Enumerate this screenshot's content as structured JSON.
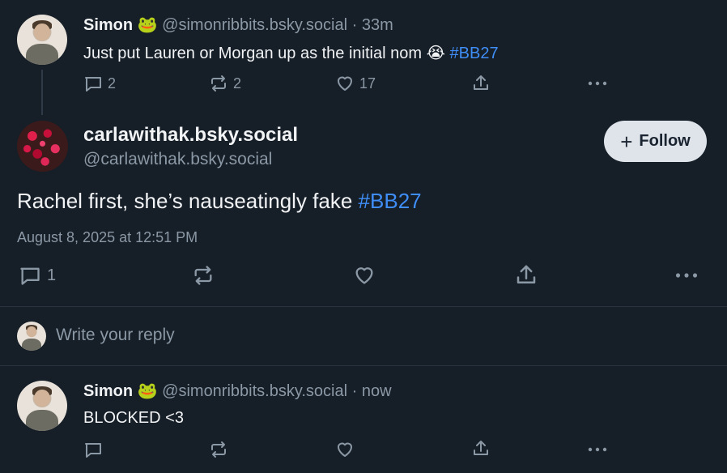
{
  "parent_post": {
    "display_name": "Simon",
    "name_emoji": "🐸",
    "handle": "@simonribbits.bsky.social",
    "separator": "·",
    "time": "33m",
    "text": "Just put Lauren or Morgan up as the initial nom",
    "text_emoji": "😭",
    "hashtag": "#BB27",
    "reply_count": "2",
    "repost_count": "2",
    "like_count": "17"
  },
  "main_post": {
    "display_name": "carlawithak.bsky.social",
    "handle": "@carlawithak.bsky.social",
    "follow_label": "Follow",
    "follow_icon": "+",
    "text": "Rachel first, she’s nauseatingly fake",
    "hashtag": "#BB27",
    "timestamp": "August 8, 2025 at 12:51 PM",
    "reply_count": "1"
  },
  "reply_box": {
    "placeholder": "Write your reply"
  },
  "reply_post": {
    "display_name": "Simon",
    "name_emoji": "🐸",
    "handle": "@simonribbits.bsky.social",
    "separator": "·",
    "time": "now",
    "text": "BLOCKED <3"
  },
  "colors": {
    "background": "#161e27",
    "link": "#3f8ef7",
    "muted": "#8b98a5",
    "follow_bg": "#dfe4ea"
  }
}
